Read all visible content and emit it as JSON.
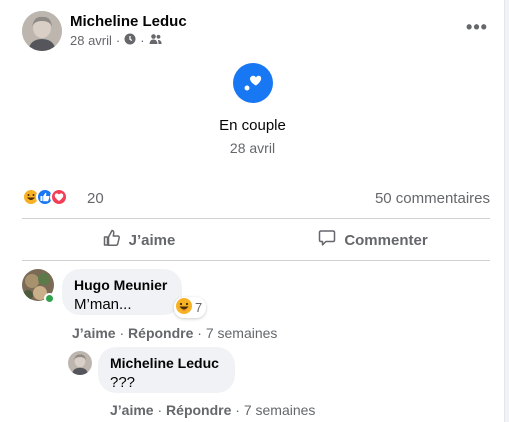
{
  "post": {
    "author": "Micheline Leduc",
    "date": "28 avril",
    "separator": "·",
    "privacy_icon": "friends-icon",
    "time_icon": "clock-icon",
    "more_icon": "more-options-icon"
  },
  "life_event": {
    "icon": "heart-event-icon",
    "title": "En couple",
    "date": "28 avril"
  },
  "reactions": {
    "icons": [
      "haha-reaction-icon",
      "like-reaction-icon",
      "love-reaction-icon"
    ],
    "count": "20",
    "comments_label": "50 commentaires"
  },
  "actions": {
    "like_label": "J’aime",
    "comment_label": "Commenter"
  },
  "comments": [
    {
      "author": "Hugo Meunier",
      "text": "M’man...",
      "reaction_count": "7",
      "like": "J’aime",
      "reply": "Répondre",
      "time": "7 semaines",
      "dot": "·"
    },
    {
      "author": "Micheline Leduc",
      "text": "???",
      "like": "J’aime",
      "reply": "Répondre",
      "time": "7 semaines",
      "dot": "·"
    }
  ],
  "colors": {
    "accent": "#1877f2",
    "online": "#31a24c",
    "love": "#f33e58",
    "haha": "#f7b125"
  }
}
